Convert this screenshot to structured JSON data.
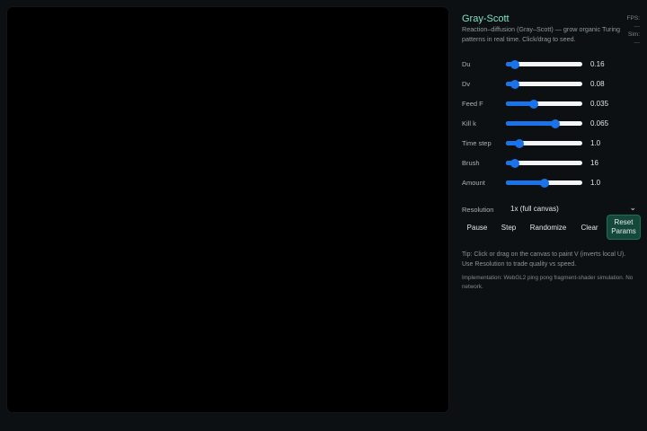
{
  "app": {
    "title": "Gray-Scott",
    "subtitle": "Reaction–diffusion (Gray–Scott) — grow organic Turing patterns in real time. Click/drag to seed.",
    "fps_label": "FPS:",
    "fps_value": "—",
    "sim_label": "Sim:",
    "sim_value": "—"
  },
  "controls": [
    {
      "label": "Du",
      "value": "0.16",
      "level": 0.12
    },
    {
      "label": "Dv",
      "value": "0.08",
      "level": 0.12
    },
    {
      "label": "Feed F",
      "value": "0.035",
      "level": 0.37
    },
    {
      "label": "Kill k",
      "value": "0.065",
      "level": 0.65
    },
    {
      "label": "Time step",
      "value": "1.0",
      "level": 0.18
    },
    {
      "label": "Brush",
      "value": "16",
      "level": 0.12
    },
    {
      "label": "Amount",
      "value": "1.0",
      "level": 0.5
    }
  ],
  "resolution": {
    "label": "Resolution",
    "selected": "1x (full canvas)"
  },
  "buttons": {
    "pause": "Pause",
    "step": "Step",
    "randomize": "Randomize",
    "clear": "Clear",
    "reset_line1": "Reset",
    "reset_line2": "Params"
  },
  "tip": "Tip: Click or drag on the canvas to paint V (inverts local U). Use Resolution to trade quality vs speed.",
  "implementation": "Implementation: WebGL2 ping pong fragment-shader simulation. No network.",
  "colors": {
    "accent": "#1a73e8",
    "title": "#7fe3c7",
    "primary_button": "#14493a"
  }
}
